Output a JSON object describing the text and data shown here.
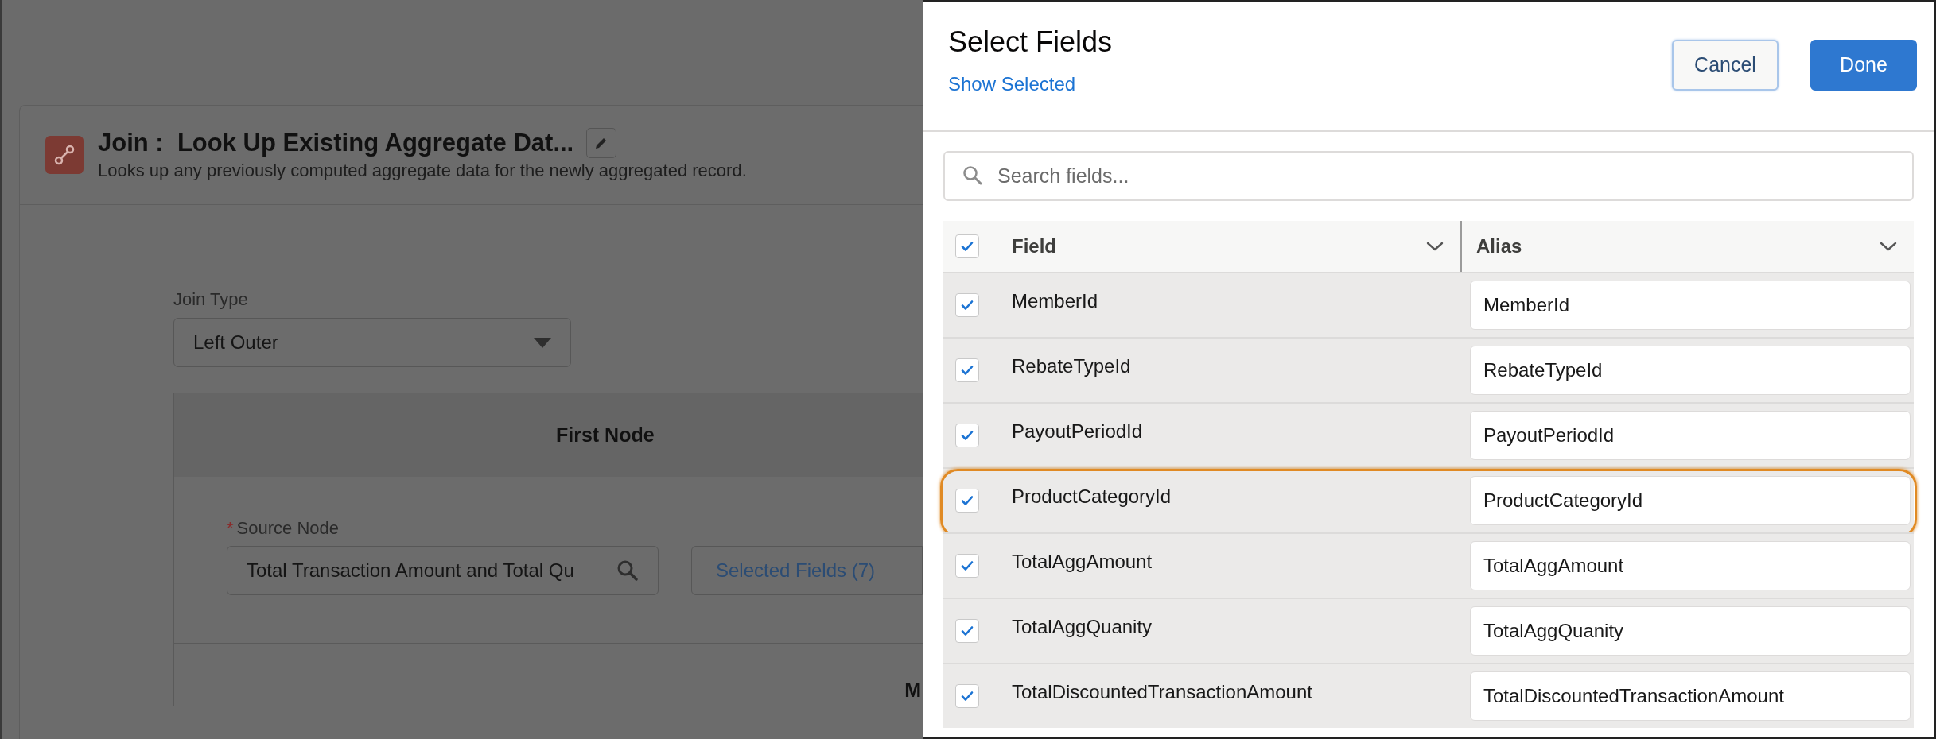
{
  "background_page": {
    "node_header": {
      "title": "Join :  Look Up Existing Aggregate Dat...",
      "description": "Looks up any previously computed aggregate data for the newly aggregated record."
    },
    "join_type": {
      "label": "Join Type",
      "value": "Left Outer"
    },
    "first_node": {
      "title": "First Node",
      "source_node": {
        "required_marker": "*",
        "label": "Source Node",
        "value": "Total Transaction Amount and Total Qu"
      },
      "selected_fields_button": "Selected Fields (7)"
    },
    "section_2": {
      "title": "M"
    }
  },
  "dialog": {
    "title": "Select Fields",
    "show_selected_link": "Show Selected",
    "buttons": [
      {
        "label": "Cancel",
        "kind": "neutral"
      },
      {
        "label": "Done",
        "kind": "brand"
      }
    ],
    "search": {
      "placeholder": "Search fields..."
    },
    "table": {
      "select_all_checked": true,
      "columns": [
        "Field",
        "Alias"
      ],
      "rows": [
        {
          "field": "MemberId",
          "alias": "MemberId",
          "checked": true,
          "highlighted": false
        },
        {
          "field": "RebateTypeId",
          "alias": "RebateTypeId",
          "checked": true,
          "highlighted": false
        },
        {
          "field": "PayoutPeriodId",
          "alias": "PayoutPeriodId",
          "checked": true,
          "highlighted": false
        },
        {
          "field": "ProductCategoryId",
          "alias": "ProductCategoryId",
          "checked": true,
          "highlighted": true
        },
        {
          "field": "TotalAggAmount",
          "alias": "TotalAggAmount",
          "checked": true,
          "highlighted": false
        },
        {
          "field": "TotalAggQuanity",
          "alias": "TotalAggQuanity",
          "checked": true,
          "highlighted": false
        },
        {
          "field": "TotalDiscountedTransactionAmount",
          "alias": "TotalDiscountedTransactionAmount",
          "checked": true,
          "highlighted": false
        }
      ]
    }
  }
}
